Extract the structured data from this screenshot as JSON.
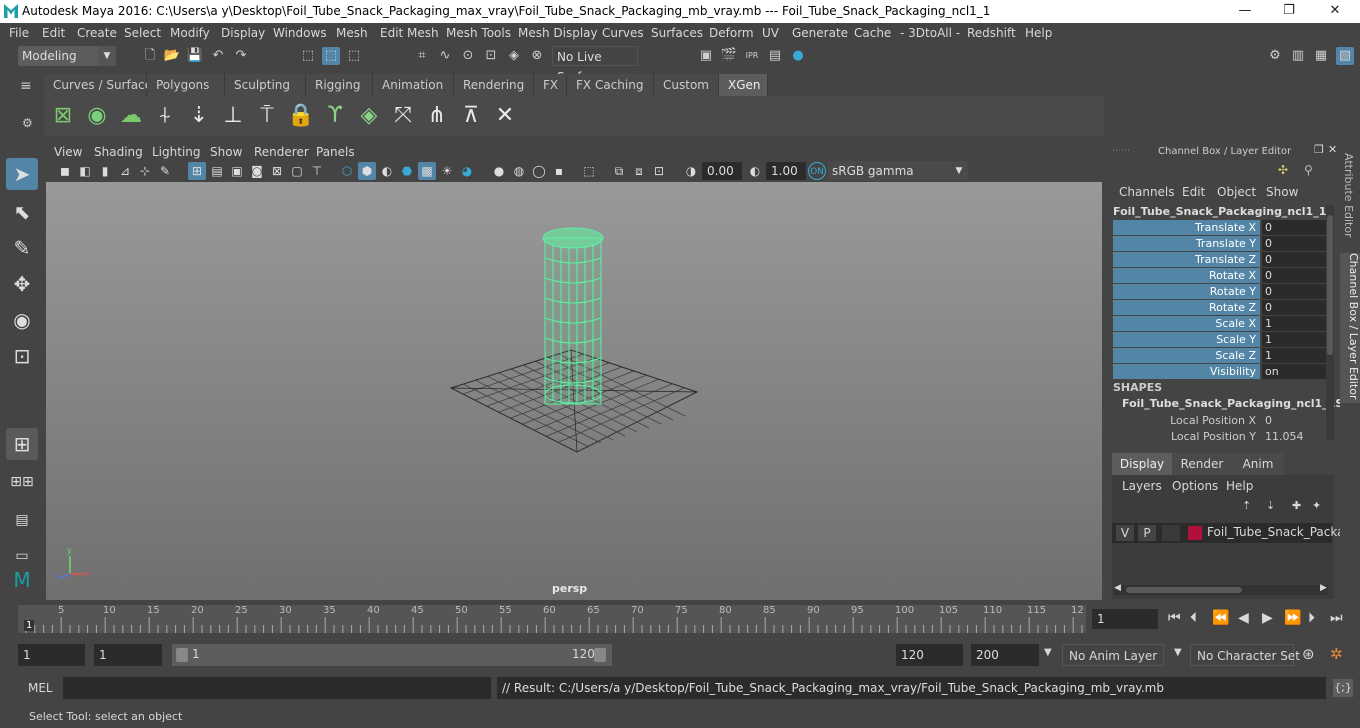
{
  "window": {
    "title": "Autodesk Maya 2016: C:\\Users\\a y\\Desktop\\Foil_Tube_Snack_Packaging_max_vray\\Foil_Tube_Snack_Packaging_mb_vray.mb   ---   Foil_Tube_Snack_Packaging_ncl1_1",
    "minimize": "—",
    "maximize": "❐",
    "close": "✕"
  },
  "menu": [
    "File",
    "Edit",
    "Create",
    "Select",
    "Modify",
    "Display",
    "Windows",
    "Mesh",
    "Edit Mesh",
    "Mesh Tools",
    "Mesh Display",
    "Curves",
    "Surfaces",
    "Deform",
    "UV",
    "Generate",
    "Cache",
    "- 3DtoAll -",
    "Redshift",
    "Help"
  ],
  "status": {
    "mode": "Modeling",
    "live_surface": "No Live Surface"
  },
  "shelf_tabs": [
    "Curves / Surfaces",
    "Polygons",
    "Sculpting",
    "Rigging",
    "Animation",
    "Rendering",
    "FX",
    "FX Caching",
    "Custom",
    "XGen"
  ],
  "shelf_active": "XGen",
  "viewport_menu": [
    "View",
    "Shading",
    "Lighting",
    "Show",
    "Renderer",
    "Panels"
  ],
  "viewport_toolbar": {
    "exposure": "0.00",
    "gamma": "1.00",
    "color_space": "sRGB gamma"
  },
  "viewport_label": "persp",
  "channel_box": {
    "header": "Channel Box / Layer Editor",
    "menus": [
      "Channels",
      "Edit",
      "Object",
      "Show"
    ],
    "object": "Foil_Tube_Snack_Packaging_ncl1_1",
    "channels": [
      {
        "name": "Translate X",
        "value": "0"
      },
      {
        "name": "Translate Y",
        "value": "0"
      },
      {
        "name": "Translate Z",
        "value": "0"
      },
      {
        "name": "Rotate X",
        "value": "0"
      },
      {
        "name": "Rotate Y",
        "value": "0"
      },
      {
        "name": "Rotate Z",
        "value": "0"
      },
      {
        "name": "Scale X",
        "value": "1"
      },
      {
        "name": "Scale Y",
        "value": "1"
      },
      {
        "name": "Scale Z",
        "value": "1"
      },
      {
        "name": "Visibility",
        "value": "on"
      }
    ],
    "shapes_label": "SHAPES",
    "shape_name": "Foil_Tube_Snack_Packaging_ncl1_1S...",
    "local": [
      {
        "name": "Local Position X",
        "value": "0"
      },
      {
        "name": "Local Position Y",
        "value": "11.054"
      }
    ]
  },
  "layer_editor": {
    "tabs": [
      "Display",
      "Render",
      "Anim"
    ],
    "active_tab": "Display",
    "menus": [
      "Layers",
      "Options",
      "Help"
    ],
    "layer": {
      "v": "V",
      "p": "P",
      "name": "Foil_Tube_Snack_Packag",
      "color": "#b0103a"
    }
  },
  "side_tabs": {
    "attribute": "Attribute Editor",
    "channel": "Channel Box / Layer Editor"
  },
  "timeline": {
    "ticks": [
      "5",
      "10",
      "15",
      "20",
      "25",
      "30",
      "35",
      "40",
      "45",
      "50",
      "55",
      "60",
      "65",
      "70",
      "75",
      "80",
      "85",
      "90",
      "95",
      "100",
      "105",
      "110",
      "115",
      "12"
    ],
    "start_marker": "1",
    "current_frame": "1"
  },
  "range": {
    "start": "1",
    "start2": "1",
    "slider_start": "1",
    "slider_end": "120",
    "end": "120",
    "end2": "200",
    "anim_layer": "No Anim Layer",
    "char_set": "No Character Set"
  },
  "mel": {
    "label": "MEL",
    "result": "// Result: C:/Users/a y/Desktop/Foil_Tube_Snack_Packaging_max_vray/Foil_Tube_Snack_Packaging_mb_vray.mb"
  },
  "help_line": "Select Tool: select an object",
  "colors": {
    "accent_green": "#5ef2a0",
    "channel_blue": "#5285a6",
    "xgen_tab": "#5d5d5d"
  }
}
